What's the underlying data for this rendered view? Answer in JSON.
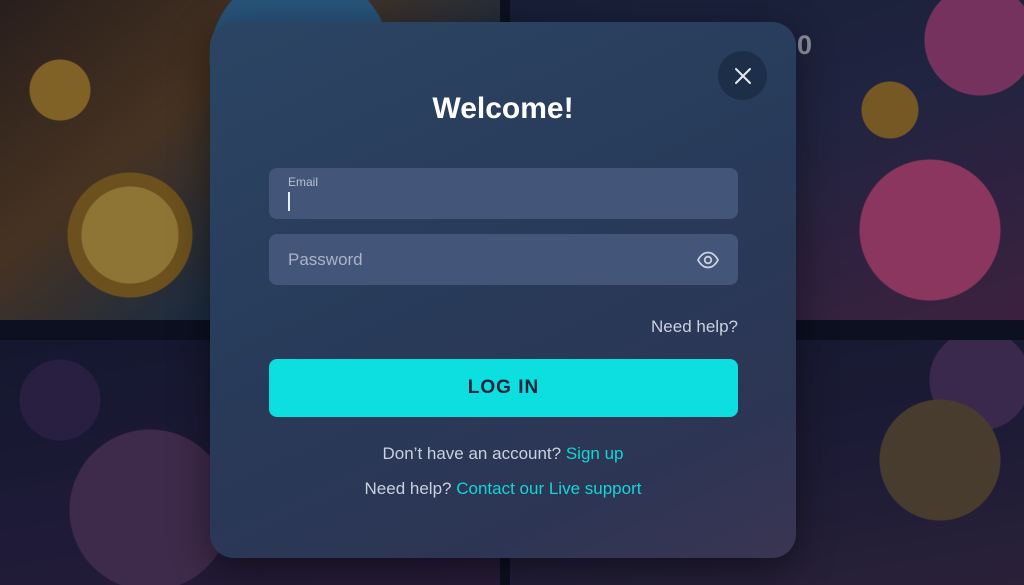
{
  "background": {
    "peek_text": "0"
  },
  "modal": {
    "title": "Welcome!",
    "close_icon": "close-icon",
    "email": {
      "label": "Email",
      "value": ""
    },
    "password": {
      "placeholder": "Password",
      "value": "",
      "toggle_icon": "eye-icon"
    },
    "need_help_label": "Need help?",
    "login_label": "LOG IN",
    "signup_prompt": "Don’t have an account?",
    "signup_link": "Sign up",
    "support_prompt": "Need help?",
    "support_link": "Contact our Live support"
  },
  "colors": {
    "accent": "#0ddfe0",
    "link": "#12d6d8",
    "modal_bg": "#283b5a",
    "field_bg": "#44557a"
  }
}
